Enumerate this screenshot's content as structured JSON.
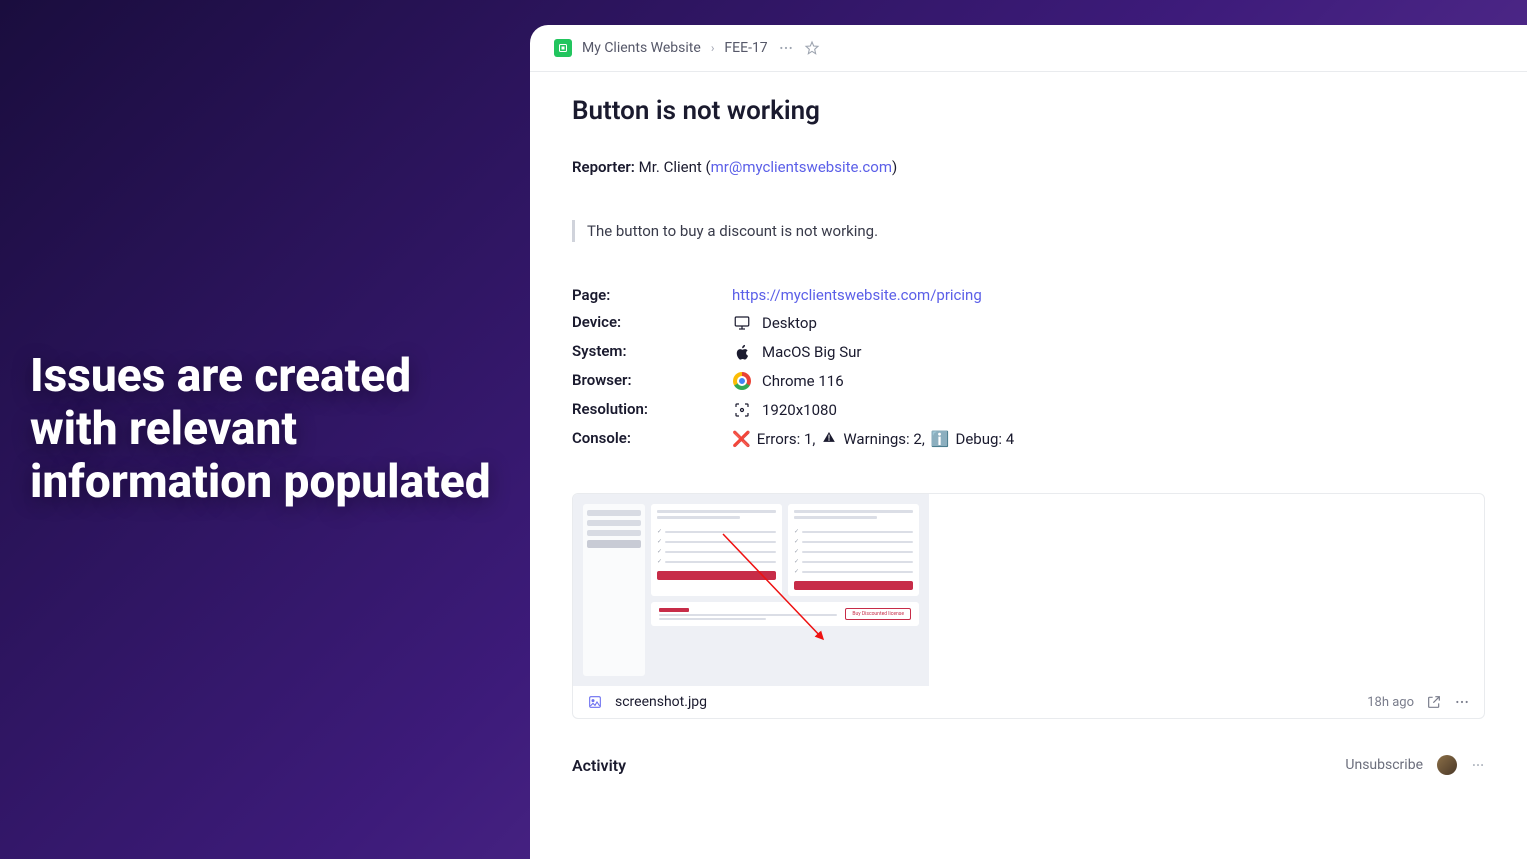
{
  "hero": "Issues are created with relevant information populated",
  "breadcrumb": {
    "project": "My Clients Website",
    "issue_id": "FEE-17"
  },
  "issue": {
    "title": "Button is not working",
    "reporter_label": "Reporter:",
    "reporter_name": "Mr. Client",
    "reporter_email": "mr@myclientswebsite.com",
    "description": "The button to buy a discount is not working."
  },
  "meta": {
    "page_label": "Page:",
    "page_url": "https://myclientswebsite.com/pricing",
    "device_label": "Device:",
    "device_value": "Desktop",
    "system_label": "System:",
    "system_value": "MacOS Big Sur",
    "browser_label": "Browser:",
    "browser_value": "Chrome 116",
    "resolution_label": "Resolution:",
    "resolution_value": "1920x1080",
    "console_label": "Console:",
    "console_errors": "Errors: 1,",
    "console_warnings": "Warnings: 2,",
    "console_debug": "Debug: 4"
  },
  "attachment": {
    "filename": "screenshot.jpg",
    "time": "18h ago",
    "thumb_discount_label": "Buy Discounted license"
  },
  "activity": {
    "title": "Activity",
    "unsubscribe": "Unsubscribe"
  }
}
